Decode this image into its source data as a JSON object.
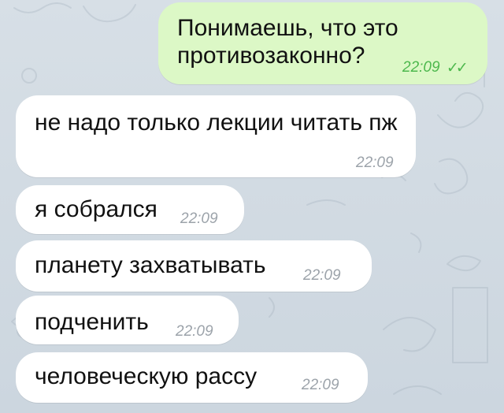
{
  "chat": {
    "messages": [
      {
        "text": "Понимаешь, что это противозаконно?",
        "time": "22:09",
        "status_icon": "double-check-icon",
        "direction": "outgoing"
      },
      {
        "text": "не надо только лекции читать пж",
        "time": "22:09",
        "direction": "incoming"
      },
      {
        "text": "я собрался",
        "time": "22:09",
        "direction": "incoming"
      },
      {
        "text": "планету захватывать",
        "time": "22:09",
        "direction": "incoming"
      },
      {
        "text": "подченить",
        "time": "22:09",
        "direction": "incoming"
      },
      {
        "text": "человеческую рассу",
        "time": "22:09",
        "direction": "incoming"
      }
    ]
  },
  "colors": {
    "chat_background": "#cfd8e0",
    "incoming_bubble": "#ffffff",
    "outgoing_bubble": "#dcf8c6",
    "outgoing_meta": "#4db84d",
    "incoming_meta": "#9ca3aa"
  }
}
